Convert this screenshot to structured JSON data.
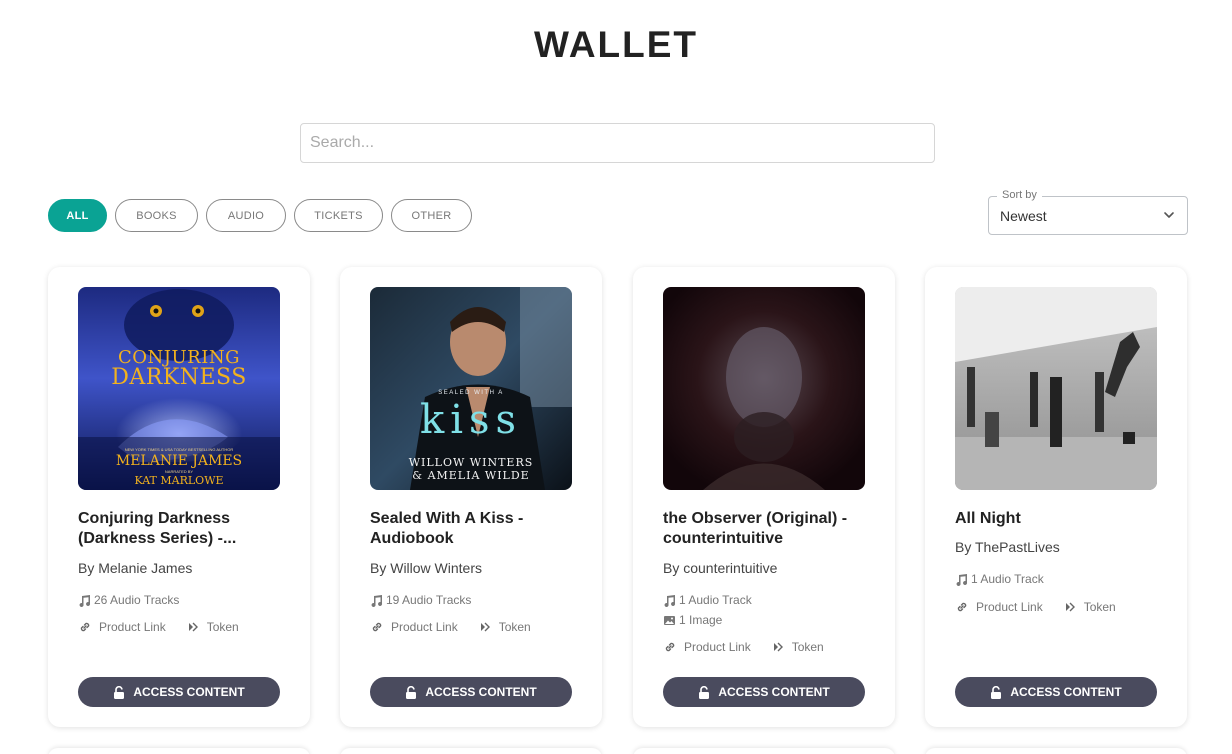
{
  "page": {
    "title": "WALLET"
  },
  "search": {
    "placeholder": "Search..."
  },
  "filters": [
    {
      "label": "ALL",
      "active": true
    },
    {
      "label": "BOOKS",
      "active": false
    },
    {
      "label": "AUDIO",
      "active": false
    },
    {
      "label": "TICKETS",
      "active": false
    },
    {
      "label": "OTHER",
      "active": false
    }
  ],
  "sort": {
    "legend": "Sort by",
    "value": "Newest"
  },
  "colors": {
    "accent": "#0aa394",
    "button": "#4a4b5e"
  },
  "cards": [
    {
      "cover_text": {
        "line1": "CONJURING",
        "line2": "DARKNESS",
        "sub": "NEW YORK TIMES & USA TODAY BESTSELLING AUTHOR",
        "author": "MELANIE JAMES",
        "narrator_label": "NARRATED BY",
        "narrator": "KAT MARLOWE"
      },
      "title": "Conjuring Darkness (Darkness Series) -...",
      "author": "By Melanie James",
      "meta": [
        {
          "icon": "music-note-icon",
          "text": "26 Audio Tracks"
        }
      ],
      "link_label": "Product Link",
      "token_label": "Token",
      "button": "ACCESS CONTENT"
    },
    {
      "cover_text": {
        "line1": "SEALED WITH A",
        "line2": "kiss",
        "author1": "WILLOW WINTERS",
        "author2": "& AMELIA WILDE"
      },
      "title": "Sealed With A Kiss - Audiobook",
      "author": "By Willow Winters",
      "meta": [
        {
          "icon": "music-note-icon",
          "text": "19 Audio Tracks"
        }
      ],
      "link_label": "Product Link",
      "token_label": "Token",
      "button": "ACCESS CONTENT"
    },
    {
      "title": "the Observer (Original) - counterintuitive",
      "author": "By counterintuitive",
      "meta": [
        {
          "icon": "music-note-icon",
          "text": "1 Audio Track"
        },
        {
          "icon": "image-icon",
          "text": "1 Image"
        }
      ],
      "link_label": "Product Link",
      "token_label": "Token",
      "button": "ACCESS CONTENT"
    },
    {
      "title": "All Night",
      "author": "By ThePastLives",
      "meta": [
        {
          "icon": "music-note-icon",
          "text": "1 Audio Track"
        }
      ],
      "link_label": "Product Link",
      "token_label": "Token",
      "button": "ACCESS CONTENT"
    }
  ]
}
